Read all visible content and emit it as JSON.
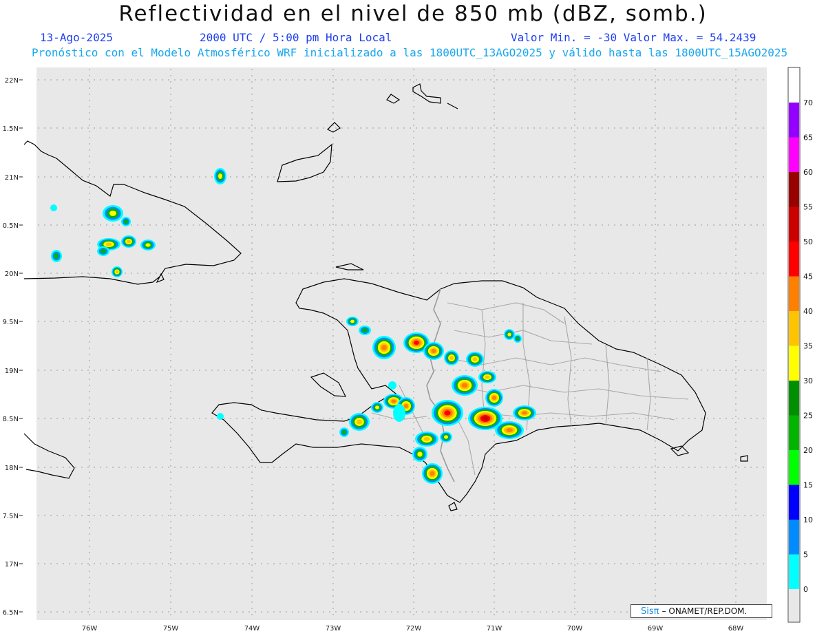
{
  "title": "Reflectividad en el nivel de 850 mb (dBZ, somb.)",
  "date": "13-Ago-2025",
  "time": "2000 UTC / 5:00 pm Hora Local",
  "minmax": "Valor Min. = -30  Valor Max. = 54.2439",
  "forecast": "Pronóstico con el Modelo Atmosférico WRF inicializado a las 1800UTC_13AGO2025 y válido hasta las  1800UTC_15AGO2025",
  "credit": {
    "brand": "Sisπ",
    "org": "– ONAMET/REP.DOM."
  },
  "colors": {
    "ocean": "#e8e8e8",
    "grid": "#999999",
    "coast": "#000000",
    "border": "#9a9a9a",
    "title_text": "#111111",
    "header_blue": "#1e3ef2",
    "header_cyan": "#19a7ee"
  },
  "map": {
    "lon_ticks": [
      "76W",
      "75W",
      "74W",
      "73W",
      "72W",
      "71W",
      "70W",
      "69W",
      "68W"
    ],
    "lat_ticks": [
      "22N",
      "1.5N",
      "21N",
      "0.5N",
      "20N",
      "9.5N",
      "19N",
      "8.5N",
      "18N",
      "7.5N",
      "17N",
      "6.5N"
    ],
    "grid_lines": true
  },
  "legend": {
    "labels": [
      "70",
      "65",
      "60",
      "55",
      "50",
      "45",
      "40",
      "35",
      "30",
      "25",
      "20",
      "15",
      "10",
      "5",
      "0"
    ],
    "colors": [
      "#9400ff",
      "#ff00ff",
      "#990000",
      "#cc0000",
      "#ff0000",
      "#ff7f00",
      "#ffc400",
      "#ffff00",
      "#008f00",
      "#00b400",
      "#00ff00",
      "#0000ff",
      "#008cff",
      "#00ffff",
      "#e8e8e8"
    ]
  }
}
